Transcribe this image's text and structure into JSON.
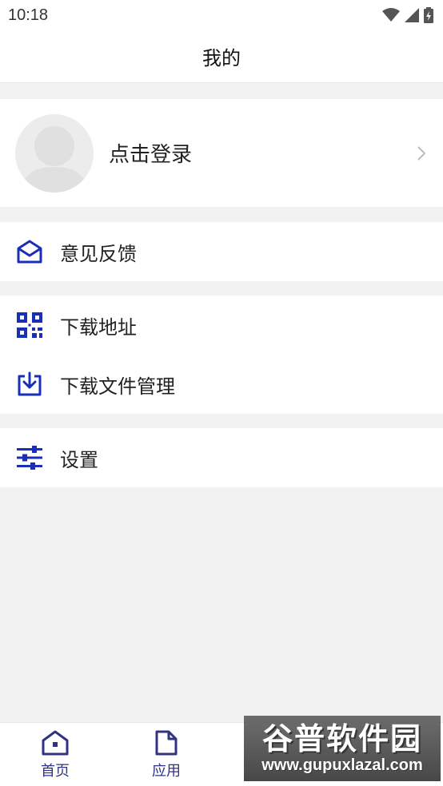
{
  "status_bar": {
    "time": "10:18"
  },
  "header": {
    "title": "我的"
  },
  "profile": {
    "login_label": "点击登录"
  },
  "menu": {
    "feedback": {
      "label": "意见反馈",
      "icon": "mail-icon"
    },
    "download_address": {
      "label": "下载地址",
      "icon": "qr-code-icon"
    },
    "download_manager": {
      "label": "下载文件管理",
      "icon": "download-icon"
    },
    "settings": {
      "label": "设置",
      "icon": "sliders-icon"
    }
  },
  "tab_bar": {
    "tabs": [
      {
        "label": "首页",
        "icon": "home-icon"
      },
      {
        "label": "应用",
        "icon": "document-icon"
      }
    ]
  },
  "watermark": {
    "title": "谷普软件园",
    "url": "www.gupuxlazal.com"
  },
  "colors": {
    "accent": "#1a2fb8",
    "tab": "#2f3380",
    "background": "#f2f2f2"
  }
}
